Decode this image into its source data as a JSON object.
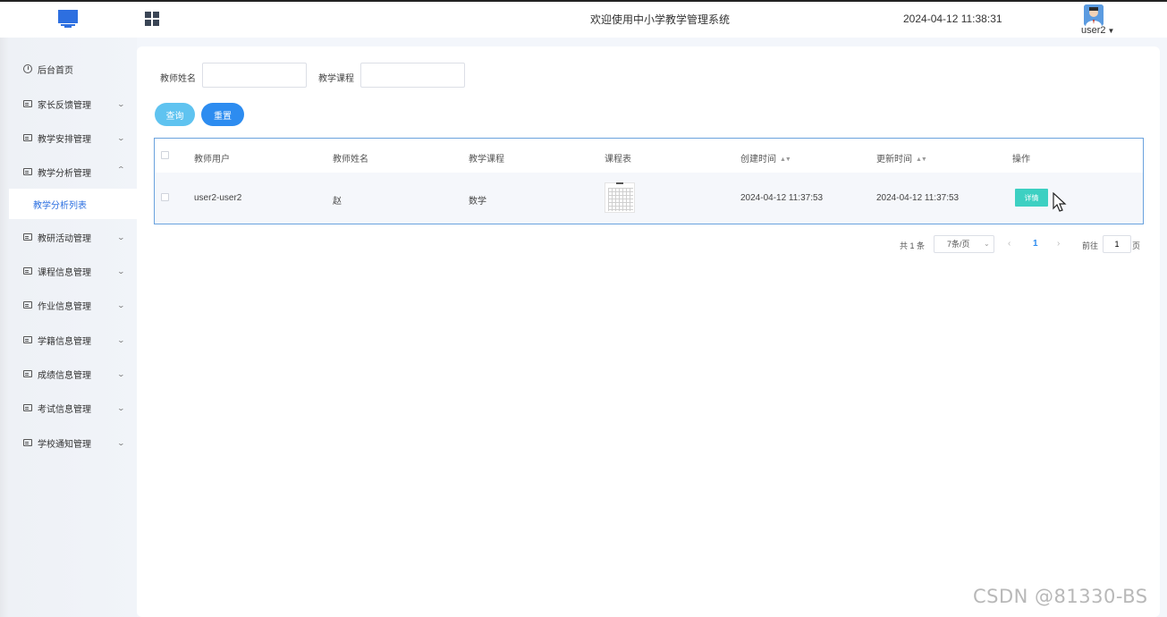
{
  "header": {
    "system_title": "欢迎使用中小学教学管理系统",
    "datetime": "2024-04-12 11:38:31",
    "username": "user2"
  },
  "sidebar": {
    "items": [
      {
        "label": "后台首页",
        "icon": "clock-icon"
      },
      {
        "label": "家长反馈管理",
        "icon": "menu-icon"
      },
      {
        "label": "教学安排管理",
        "icon": "menu-icon"
      },
      {
        "label": "教学分析管理",
        "icon": "menu-icon",
        "expanded": true
      },
      {
        "label": "教研活动管理",
        "icon": "menu-icon"
      },
      {
        "label": "课程信息管理",
        "icon": "menu-icon"
      },
      {
        "label": "作业信息管理",
        "icon": "menu-icon"
      },
      {
        "label": "学籍信息管理",
        "icon": "menu-icon"
      },
      {
        "label": "成绩信息管理",
        "icon": "menu-icon"
      },
      {
        "label": "考试信息管理",
        "icon": "menu-icon"
      },
      {
        "label": "学校通知管理",
        "icon": "menu-icon"
      }
    ],
    "active_subitem": "教学分析列表"
  },
  "filters": {
    "teacher_name_label": "教师姓名",
    "teacher_name_value": "",
    "course_label": "教学课程",
    "course_value": "",
    "search_label": "查询",
    "reset_label": "重置"
  },
  "table": {
    "columns": [
      "教师用户",
      "教师姓名",
      "教学课程",
      "课程表",
      "创建时间",
      "更新时间",
      "操作"
    ],
    "rows": [
      {
        "teacher_user": "user2-user2",
        "teacher_name": "赵",
        "course": "数学",
        "created": "2024-04-12 11:37:53",
        "updated": "2024-04-12 11:37:53",
        "action": "详情"
      }
    ]
  },
  "pagination": {
    "total": "共 1 条",
    "page_size": "7条/页",
    "current_page": "1",
    "goto_label": "前往",
    "goto_value": "1",
    "page_suffix": "页"
  },
  "watermark": "CSDN @81330-BS",
  "colors": {
    "accent": "#2d8cf0",
    "search_button": "#5fc3f0",
    "detail_button": "#3dd0c2",
    "active_menu_text": "#2c6fe0"
  }
}
